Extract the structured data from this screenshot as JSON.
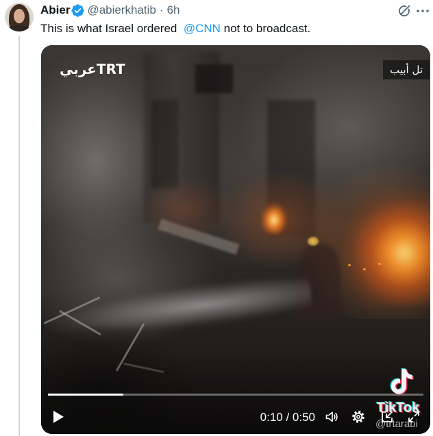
{
  "colors": {
    "accent": "#1d9bf0",
    "text_primary": "#0f1419",
    "text_secondary": "#536471",
    "thread_line": "#cfd9de"
  },
  "icons": {
    "verified": "verified-badge-icon",
    "grok": "grok-icon",
    "more": "more-icon",
    "play": "play-icon",
    "volume": "volume-icon",
    "settings": "settings-icon",
    "pip": "pip-icon",
    "fullscreen": "fullscreen-icon",
    "watermark": "tiktok-logo-icon"
  },
  "tweet": {
    "author": {
      "name": "Abier",
      "handle": "@abierkhatib",
      "verified": true
    },
    "separator": "·",
    "time": "6h",
    "text_before": "This is what Israel ordered  ",
    "mention": "@CNN",
    "text_after": " not to broadcast."
  },
  "video": {
    "channel_logo": "عربيTRT",
    "location_label": "تل أبيب",
    "current_time": "0:10",
    "time_separator": " / ",
    "duration": "0:50",
    "progress": 0.2,
    "watermark": {
      "brand": "TikTok",
      "account": "@trtarabi"
    }
  }
}
